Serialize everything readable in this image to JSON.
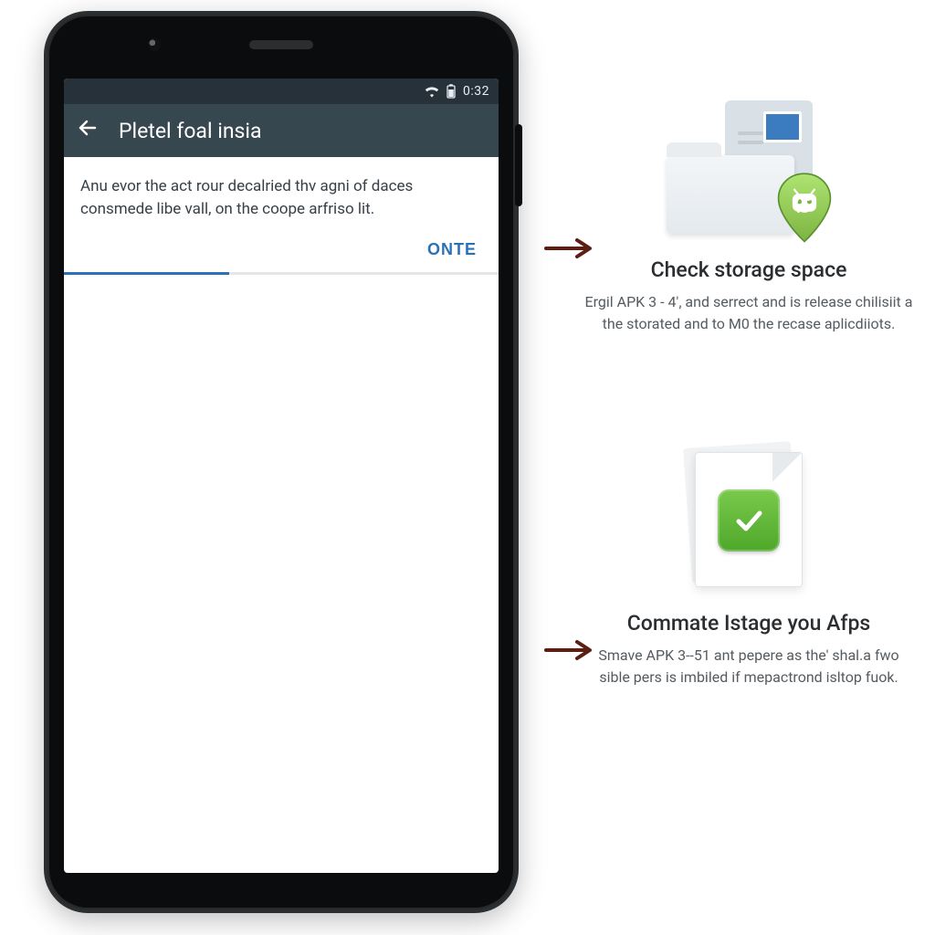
{
  "status_bar": {
    "clock": "0:32"
  },
  "app_bar": {
    "title": "Pletel foal insia"
  },
  "body_text": "Anu evor the act rour decalried thv agni of daces consmede libe vall, on the cоope arfriso lit.",
  "actions": {
    "primary": "ONTE"
  },
  "progress": {
    "percent": 38
  },
  "tips": [
    {
      "icon": "storage-icon",
      "title": "Check storage space",
      "text": "Ergil APK 3 - 4', and serrect and is release chilisiit a the storated and to M0 the recase aplicdiiots."
    },
    {
      "icon": "file-check-icon",
      "title": "Commate Istage you Afps",
      "text": "Smave APK 3--51 ant pepere as the' shal.a fwo sible pers is imbiled if mepactrond isltop fuok."
    }
  ],
  "arrows": {
    "glyph": "→"
  }
}
